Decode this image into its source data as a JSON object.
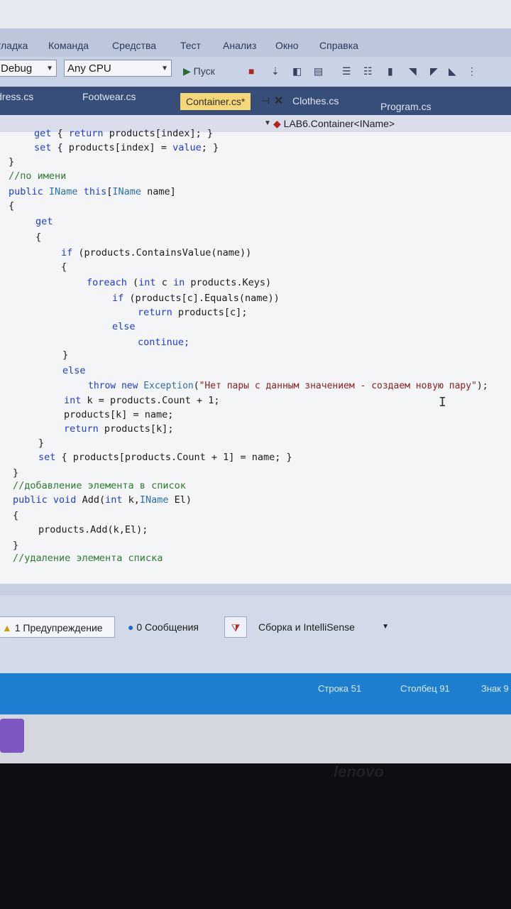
{
  "menu": [
    "Отладка",
    "Команда",
    "Средства",
    "Тест",
    "Анализ",
    "Окно",
    "Справка"
  ],
  "toolbar": {
    "config": "Debug",
    "platform": "Any CPU",
    "start_label": "Пуск"
  },
  "tabs": [
    {
      "label": "Address.cs"
    },
    {
      "label": "Footwear.cs"
    },
    {
      "label": "Container.cs*"
    },
    {
      "label": "Clothes.cs"
    },
    {
      "label": "Program.cs"
    }
  ],
  "nav": {
    "member": "LAB6.Container<IName>"
  },
  "code_lines": [
    "get { return products[index]; }",
    "set { products[index] = value; }",
    "}",
    "//по имени",
    "public IName this[IName name]",
    "{",
    "get",
    "{",
    "if (products.ContainsValue(name))",
    "{",
    "foreach (int c in products.Keys)",
    "if (products[c].Equals(name))",
    "return products[c];",
    "else",
    "continue;",
    "}",
    "else",
    "throw new Exception(\"Нет пары с данным значением - создаем новую пару\");",
    "int k = products.Count + 1;",
    "products[k] = name;",
    "return products[k];",
    "}",
    "set { products[products.Count + 1] = name; }",
    "}",
    "//добавление элемента в список",
    "public void Add(int k,IName El)",
    "{",
    "products.Add(k,El);",
    "}",
    "//удаление элемента списка"
  ],
  "errorlist": {
    "warnings": "1 Предупреждение",
    "messages": "0 Сообщения",
    "filter": "Сборка и IntelliSense"
  },
  "status": {
    "line": "Строка 51",
    "column": "Столбец 91",
    "char": "Знак 9"
  },
  "brand": "lenovo"
}
